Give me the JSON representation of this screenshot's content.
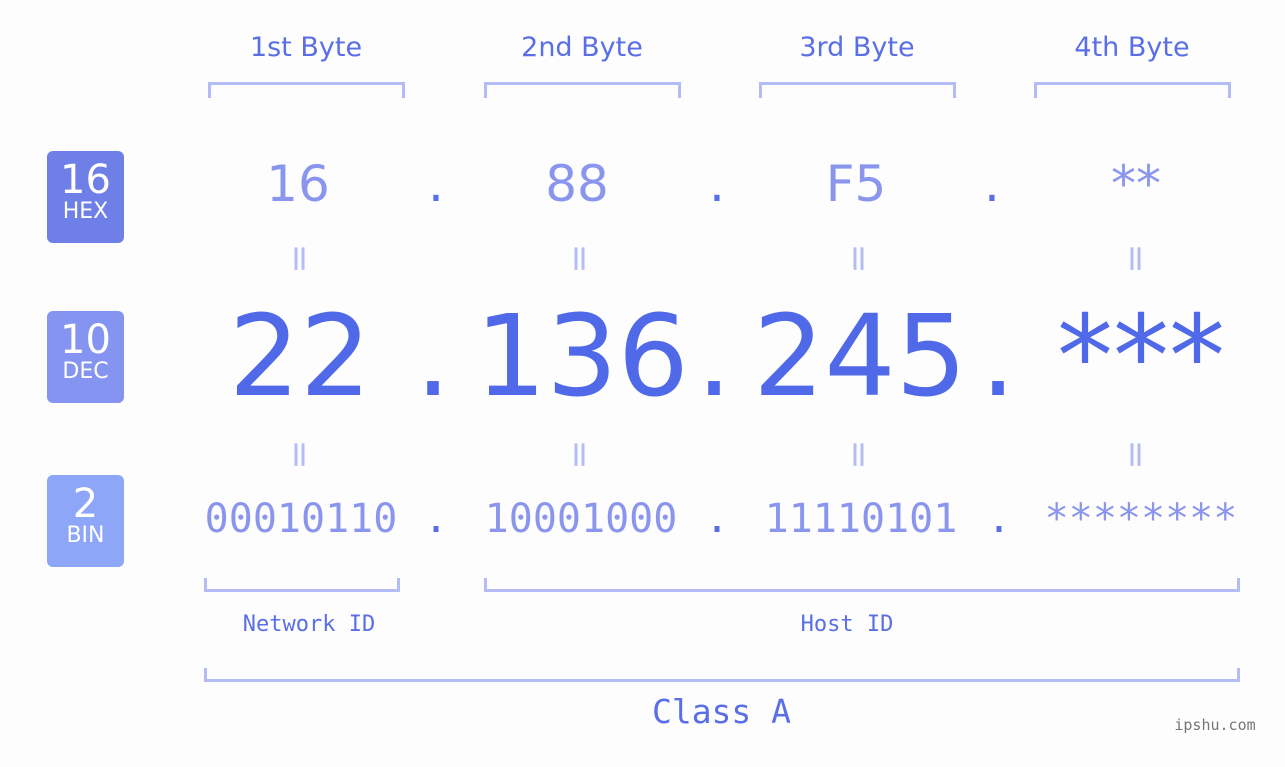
{
  "bytes": [
    {
      "label": "1st Byte",
      "hex": "16",
      "dec": "22",
      "bin": "00010110"
    },
    {
      "label": "2nd Byte",
      "hex": "88",
      "dec": "136",
      "bin": "10001000"
    },
    {
      "label": "3rd Byte",
      "hex": "F5",
      "dec": "245",
      "bin": "11110101"
    },
    {
      "label": "4th Byte",
      "hex": "**",
      "dec": "***",
      "bin": "********"
    }
  ],
  "badges": {
    "hex": {
      "num": "16",
      "label": "HEX",
      "color": "#6f7fe8"
    },
    "dec": {
      "num": "10",
      "label": "DEC",
      "color": "#8494f0"
    },
    "bin": {
      "num": "2",
      "label": "BIN",
      "color": "#8da6f7"
    }
  },
  "separator": ".",
  "equals": "=",
  "network_id_label": "Network ID",
  "host_id_label": "Host ID",
  "class_label": "Class A",
  "watermark": "ipshu.com"
}
